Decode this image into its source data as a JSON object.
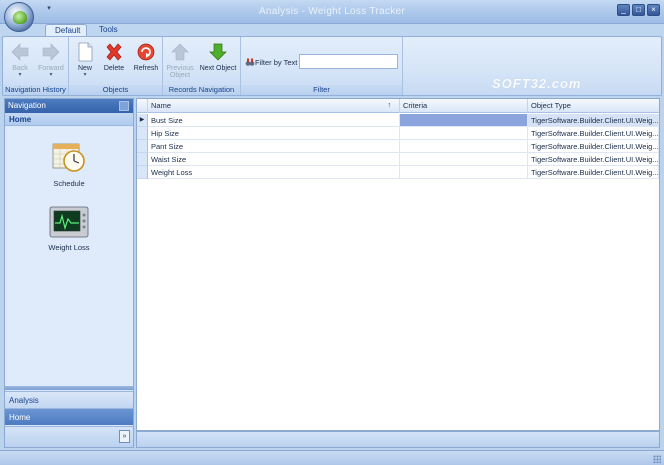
{
  "window": {
    "title": "Analysis - Weight Loss Tracker"
  },
  "qat": {
    "menu_glyph": "▾"
  },
  "window_buttons": {
    "minimize": "_",
    "maximize": "□",
    "close": "×"
  },
  "tabs": [
    {
      "label": "Default",
      "active": true
    },
    {
      "label": "Tools",
      "active": false
    }
  ],
  "ribbon": {
    "navigation_history": {
      "label": "Navigation History",
      "back": {
        "label": "Back",
        "enabled": false,
        "icon": "arrow-left-icon"
      },
      "forward": {
        "label": "Forward",
        "enabled": false,
        "icon": "arrow-right-icon"
      }
    },
    "objects": {
      "label": "Objects",
      "new": {
        "label": "New",
        "icon": "new-document-icon"
      },
      "delete": {
        "label": "Delete",
        "icon": "delete-x-icon"
      },
      "refresh": {
        "label": "Refresh",
        "icon": "refresh-icon"
      }
    },
    "records_navigation": {
      "label": "Records Navigation",
      "previous": {
        "label": "Previous Object",
        "enabled": false,
        "icon": "arrow-up-icon"
      },
      "next": {
        "label": "Next Object",
        "enabled": true,
        "icon": "arrow-down-icon"
      }
    },
    "filter": {
      "label": "Filter",
      "filter_by_text": "Filter by Text",
      "input_value": ""
    }
  },
  "watermark": "SOFT32.com",
  "navigation": {
    "header": "Navigation",
    "section": "Home",
    "items": [
      {
        "label": "Schedule",
        "icon": "schedule-icon"
      },
      {
        "label": "Weight Loss",
        "icon": "weight-loss-monitor-icon"
      }
    ],
    "groups": [
      {
        "label": "Analysis",
        "selected": false
      },
      {
        "label": "Home",
        "selected": true
      }
    ],
    "overflow_glyph": "»"
  },
  "grid": {
    "columns": [
      "Name",
      "Criteria",
      "Object Type"
    ],
    "sort_glyph": "↑",
    "current_row_glyph": "▶",
    "rows": [
      {
        "name": "Bust Size",
        "criteria": "",
        "object_type": "TigerSoftware.Builder.Client.UI.Weig...",
        "current": true
      },
      {
        "name": "Hip Size",
        "criteria": "",
        "object_type": "TigerSoftware.Builder.Client.UI.Weig...",
        "current": false
      },
      {
        "name": "Pant Size",
        "criteria": "",
        "object_type": "TigerSoftware.Builder.Client.UI.Weig...",
        "current": false
      },
      {
        "name": "Waist Size",
        "criteria": "",
        "object_type": "TigerSoftware.Builder.Client.UI.Weig...",
        "current": false
      },
      {
        "name": "Weight Loss",
        "criteria": "",
        "object_type": "TigerSoftware.Builder.Client.UI.Weig...",
        "current": false
      }
    ]
  },
  "colors": {
    "accent": "#3463ab",
    "selection": "#8ca4dd",
    "ribbon": "#d5e4f7"
  }
}
